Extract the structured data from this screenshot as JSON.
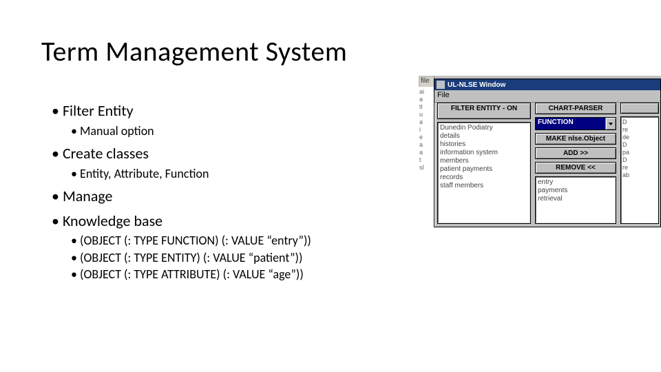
{
  "title": "Term Management System",
  "bullets": {
    "b1": "Filter Entity",
    "b1_1": "Manual option",
    "b2": "Create classes",
    "b2_1": "Entity, Attribute, Function",
    "b3": "Manage",
    "b4": "Knowledge base",
    "b4_1": "(OBJECT (: TYPE FUNCTION) (: VALUE “entry”))",
    "b4_2": "(OBJECT (: TYPE ENTITY) (: VALUE “patient”))",
    "b4_3": "(OBJECT (: TYPE ATTRIBUTE) (: VALUE “age”))"
  },
  "app": {
    "bg_title": "file",
    "bg_frag": [
      "ai",
      "a",
      "tl",
      "u",
      "",
      "a",
      "",
      "i",
      "e",
      "",
      "a",
      "a",
      "",
      "t",
      "",
      "sl"
    ],
    "window_title": "UL-NLSE Window",
    "menu_file": "File",
    "filter_btn": "FILTER ENTITY - ON",
    "chart_btn": "CHART-PARSER",
    "combo_value": "FUNCTION",
    "make_btn": "MAKE nlse.Object",
    "add_btn": "ADD >>",
    "remove_btn": "REMOVE <<",
    "left_list": [
      "Dunedin Podiatry",
      "details",
      "histories",
      "information system",
      "members",
      "patient payments",
      "records",
      "staff members"
    ],
    "mid_list": [
      "entry",
      "payments",
      "retrieval"
    ],
    "right_frag": [
      "D",
      "re",
      "de",
      "",
      "D",
      "pa",
      "",
      "D",
      "re",
      "ab"
    ]
  }
}
